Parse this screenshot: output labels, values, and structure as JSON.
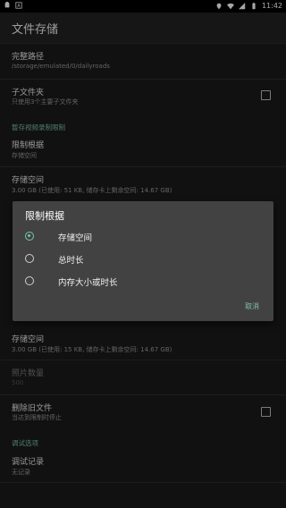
{
  "status_bar": {
    "icons_left": [
      "android-icon",
      "a-icon"
    ],
    "icons_right": [
      "location-icon",
      "wifi-icon",
      "signal-icon",
      "battery-icon"
    ],
    "time": "11:42"
  },
  "app_bar": {
    "title": "文件存储"
  },
  "settings": {
    "full_path": {
      "title": "完整路径",
      "value": "/storage/emulated/0/dailyroads"
    },
    "subfolder": {
      "title": "子文件夹",
      "summary": "只使用3个主要子文件夹",
      "checked": false
    },
    "section_video_limit": "暂存视频录制限制",
    "limit_basis": {
      "title": "限制根据",
      "value": "存储空间"
    },
    "storage_space_1": {
      "title": "存储空间",
      "summary": "3.00 GB (已使用: 51 KB, 储存卡上剩余空间: 14.67 GB)"
    },
    "storage_space_2": {
      "title": "存储空间",
      "summary": "3.00 GB (已使用: 15 KB, 储存卡上剩余空间: 14.67 GB)"
    },
    "photo_count": {
      "title": "照片数量",
      "summary": "500"
    },
    "delete_old": {
      "title": "删除旧文件",
      "summary": "当达到限制时停止",
      "checked": false
    },
    "section_debug": "调试选项",
    "debug_log": {
      "title": "调试记录",
      "summary": "无记录"
    }
  },
  "dialog": {
    "title": "限制根据",
    "options": [
      {
        "label": "存储空间",
        "selected": true
      },
      {
        "label": "总时长",
        "selected": false
      },
      {
        "label": "内存大小或时长",
        "selected": false
      }
    ],
    "cancel_label": "取消"
  },
  "colors": {
    "accent": "#6fcab0",
    "background": "#1b1b1b",
    "dialog": "#424242"
  }
}
